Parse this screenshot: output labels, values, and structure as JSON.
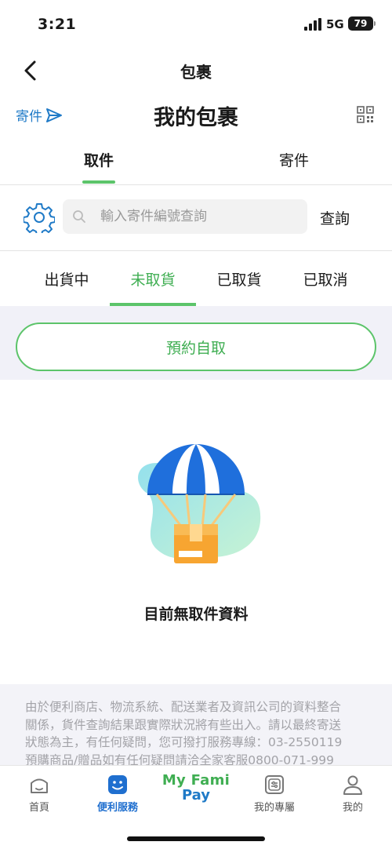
{
  "status_bar": {
    "time": "3:21",
    "network": "5G",
    "battery": "79"
  },
  "nav": {
    "title": "包裹"
  },
  "header": {
    "send_label": "寄件",
    "title": "我的包裹"
  },
  "main_tabs": [
    {
      "label": "取件",
      "active": true
    },
    {
      "label": "寄件",
      "active": false
    }
  ],
  "search": {
    "placeholder": "輸入寄件編號查詢",
    "value": "",
    "button_label": "查詢"
  },
  "status_tabs": [
    {
      "label": "出貨中",
      "active": false
    },
    {
      "label": "未取貨",
      "active": true
    },
    {
      "label": "已取貨",
      "active": false
    },
    {
      "label": "已取消",
      "active": false
    }
  ],
  "reserve_button": "預約自取",
  "empty_state": {
    "message": "目前無取件資料"
  },
  "notice": {
    "lines": [
      "由於便利商店、物流系統、配送業者及資訊公司的資料整合",
      "關係，貨件查詢結果跟實際狀況將有些出入。請以最終寄送",
      "狀態為主，有任何疑問，您可撥打服務專線：03-2550119",
      "預購商品/贈品如有任何疑問請洽全家客服0800-071-999"
    ]
  },
  "bottom_nav": {
    "items": [
      {
        "label": "首頁",
        "icon": "home-icon",
        "active": false
      },
      {
        "label": "便利服務",
        "icon": "service-icon",
        "active": true
      },
      {
        "label": "我的專屬",
        "icon": "exclusive-icon",
        "active": false
      },
      {
        "label": "我的",
        "icon": "profile-icon",
        "active": false
      }
    ],
    "famipay": {
      "line1": "My Fami",
      "line2": "Pay"
    }
  },
  "colors": {
    "accent_green": "#5cc46a",
    "link_blue": "#1f7ac7",
    "active_nav_blue": "#1f6fcf"
  }
}
